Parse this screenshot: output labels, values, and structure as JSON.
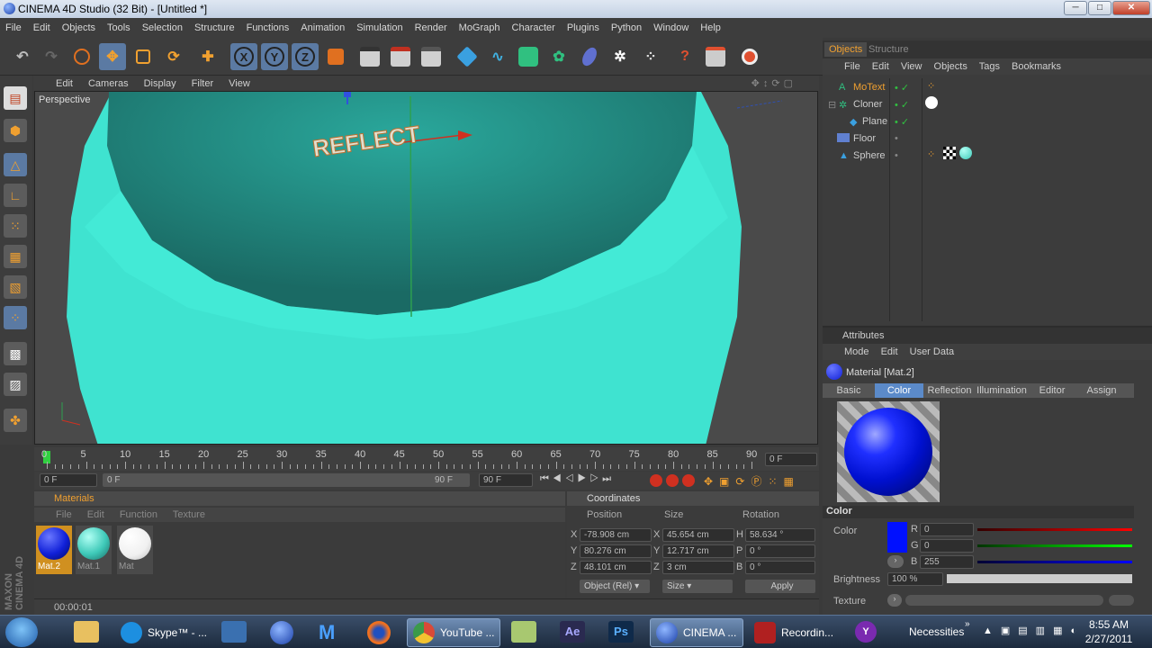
{
  "window": {
    "title": "CINEMA 4D Studio (32 Bit) - [Untitled *]",
    "minimize": "─",
    "maximize": "□",
    "close": "✕"
  },
  "menu": [
    "File",
    "Edit",
    "Objects",
    "Tools",
    "Selection",
    "Structure",
    "Functions",
    "Animation",
    "Simulation",
    "Render",
    "MoGraph",
    "Character",
    "Plugins",
    "Python",
    "Window",
    "Help"
  ],
  "viewport": {
    "menu": [
      "Edit",
      "Cameras",
      "Display",
      "Filter",
      "View"
    ],
    "label": "Perspective",
    "text3d": "REFLECT"
  },
  "timeline": {
    "ticks": [
      "0",
      "5",
      "10",
      "15",
      "20",
      "25",
      "30",
      "35",
      "40",
      "45",
      "50",
      "55",
      "60",
      "65",
      "70",
      "75",
      "80",
      "85",
      "90"
    ],
    "end_field": "0 F"
  },
  "transport": {
    "current": "0 F",
    "range_start": "0 F",
    "range_end": "90 F",
    "max": "90 F"
  },
  "materials": {
    "title": "Materials",
    "menu": [
      "File",
      "Edit",
      "Function",
      "Texture"
    ],
    "items": [
      {
        "label": "Mat.2",
        "color": "#1020d8"
      },
      {
        "label": "Mat.1",
        "color": "#3ec9b8"
      },
      {
        "label": "Mat",
        "color": "#ffffff"
      }
    ]
  },
  "coordinates": {
    "title": "Coordinates",
    "headers": [
      "Position",
      "Size",
      "Rotation"
    ],
    "rows": [
      {
        "axis": "X",
        "pos": "-78.908 cm",
        "saxis": "X",
        "size": "45.654 cm",
        "raxis": "H",
        "rot": "58.634 °"
      },
      {
        "axis": "Y",
        "pos": "80.276 cm",
        "saxis": "Y",
        "size": "12.717 cm",
        "raxis": "P",
        "rot": "0 °"
      },
      {
        "axis": "Z",
        "pos": "48.101 cm",
        "saxis": "Z",
        "size": "3 cm",
        "raxis": "B",
        "rot": "0 °"
      }
    ],
    "mode": "Object (Rel)",
    "size_mode": "Size",
    "apply": "Apply"
  },
  "status": {
    "time": "00:00:01"
  },
  "objects_panel": {
    "tabs": [
      "Objects",
      "Structure"
    ],
    "menu": [
      "File",
      "Edit",
      "View",
      "Objects",
      "Tags",
      "Bookmarks"
    ],
    "items": [
      {
        "name": "MoText",
        "highlight": true
      },
      {
        "name": "Cloner",
        "highlight": false
      },
      {
        "name": "Plane",
        "highlight": false
      },
      {
        "name": "Floor",
        "highlight": false
      },
      {
        "name": "Sphere",
        "highlight": false
      }
    ]
  },
  "attributes": {
    "title": "Attributes",
    "menu": [
      "Mode",
      "Edit",
      "User Data"
    ],
    "material_name": "Material [Mat.2]",
    "tabs": [
      "Basic",
      "Color",
      "Reflection",
      "Illumination",
      "Editor",
      "Assign"
    ],
    "active_tab": "Color",
    "section": "Color",
    "color_label": "Color",
    "r_label": "R",
    "r": "0",
    "g_label": "G",
    "g": "0",
    "b_label": "B",
    "b": "255",
    "brightness_label": "Brightness",
    "brightness": "100 %",
    "texture_label": "Texture",
    "swatch": "#0010ff"
  },
  "taskbar": {
    "items": [
      {
        "label": "Skype™ - ...",
        "color": "#1d8fe0"
      },
      {
        "label": "YouTube ...",
        "color": "#d94a38"
      },
      {
        "label": "CINEMA ...",
        "color": "#2a40b0"
      },
      {
        "label": "Recordin...",
        "color": "#b02020"
      }
    ],
    "tray_label": "Necessities",
    "time": "8:55 AM",
    "date": "2/27/2011"
  }
}
